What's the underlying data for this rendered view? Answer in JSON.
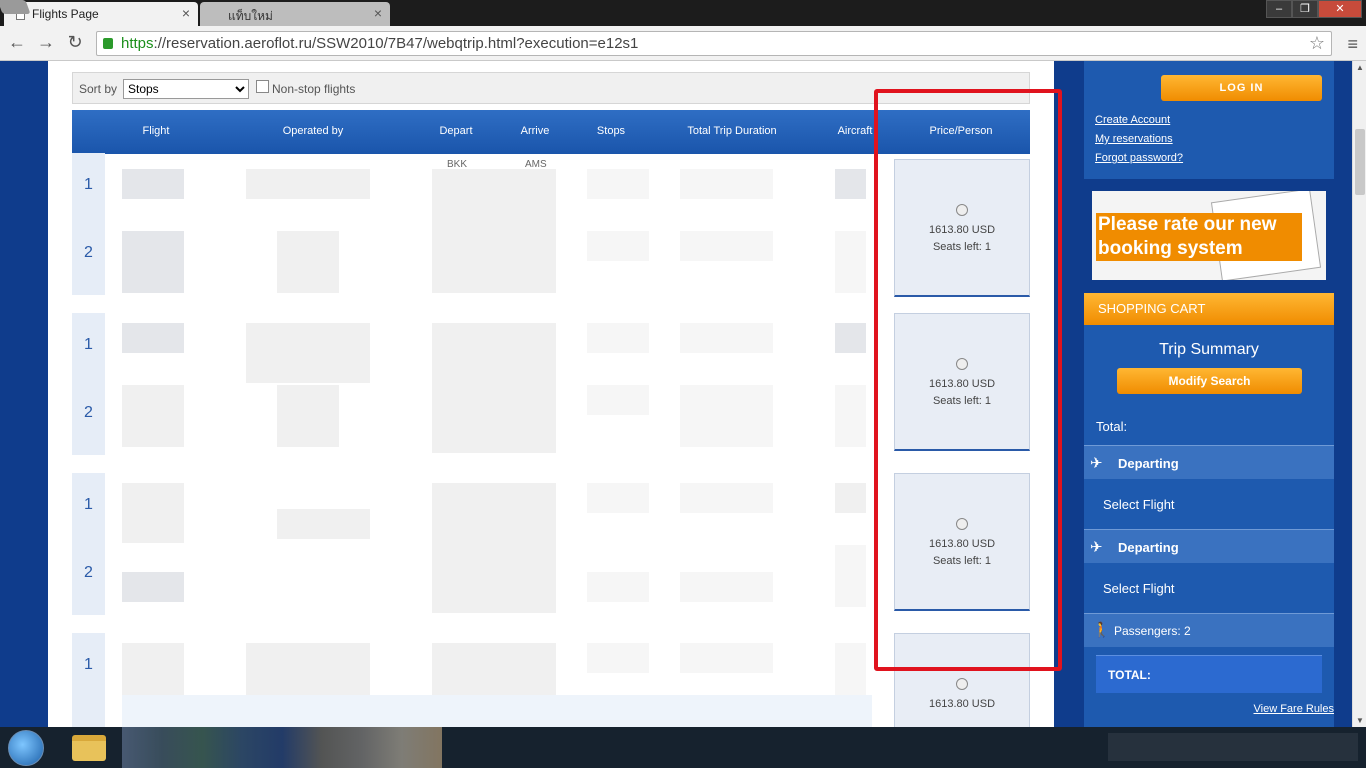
{
  "browser": {
    "tabs": [
      {
        "title": "Flights Page",
        "close": "×"
      },
      {
        "title": "แท็บใหม่",
        "close": "×"
      }
    ],
    "url_scheme": "https",
    "url_rest": "://reservation.aeroflot.ru/SSW2010/7B47/webqtrip.html?execution=e12s1",
    "back": "←",
    "forward": "→",
    "reload": "↻",
    "star": "☆",
    "menu": "≡",
    "window": {
      "minimize": "–",
      "maximize": "❐",
      "close": "✕"
    }
  },
  "sortbar": {
    "label": "Sort by",
    "selected": "Stops",
    "nonstop_label": "Non-stop flights"
  },
  "table": {
    "columns": [
      "Flight",
      "Operated by",
      "Depart",
      "Arrive",
      "Stops",
      "Total Trip Duration",
      "Aircraft",
      "Price/Person"
    ],
    "depart_code": "BKK",
    "arrive_code": "AMS",
    "options": [
      {
        "segments": [
          "1",
          "2"
        ],
        "price": "1613.80 USD",
        "seats": "Seats left: 1"
      },
      {
        "segments": [
          "1",
          "2"
        ],
        "price": "1613.80 USD",
        "seats": "Seats left: 1"
      },
      {
        "segments": [
          "1",
          "2"
        ],
        "price": "1613.80 USD",
        "seats": "Seats left: 1"
      },
      {
        "segments": [
          "1"
        ],
        "price": "1613.80 USD",
        "seats": ""
      }
    ]
  },
  "sidebar": {
    "login_label": "LOG IN",
    "links": [
      "Create Account",
      "My reservations",
      "Forgot password?"
    ],
    "banner_text": "Please rate our new booking system",
    "cart_title": "SHOPPING CART",
    "trip_summary": "Trip Summary",
    "modify_label": "Modify Search",
    "total_label": "Total:",
    "legs": [
      {
        "title": "Departing",
        "action": "Select Flight"
      },
      {
        "title": "Departing",
        "action": "Select Flight"
      }
    ],
    "passengers": "Passengers: 2",
    "total_bar": "TOTAL:",
    "fare_rules": "View Fare Rules"
  },
  "colors": {
    "page_bg": "#0f3c8c",
    "accent_orange": "#f08c00",
    "header_blue": "#1a55ab",
    "highlight_red": "#e0131e"
  }
}
